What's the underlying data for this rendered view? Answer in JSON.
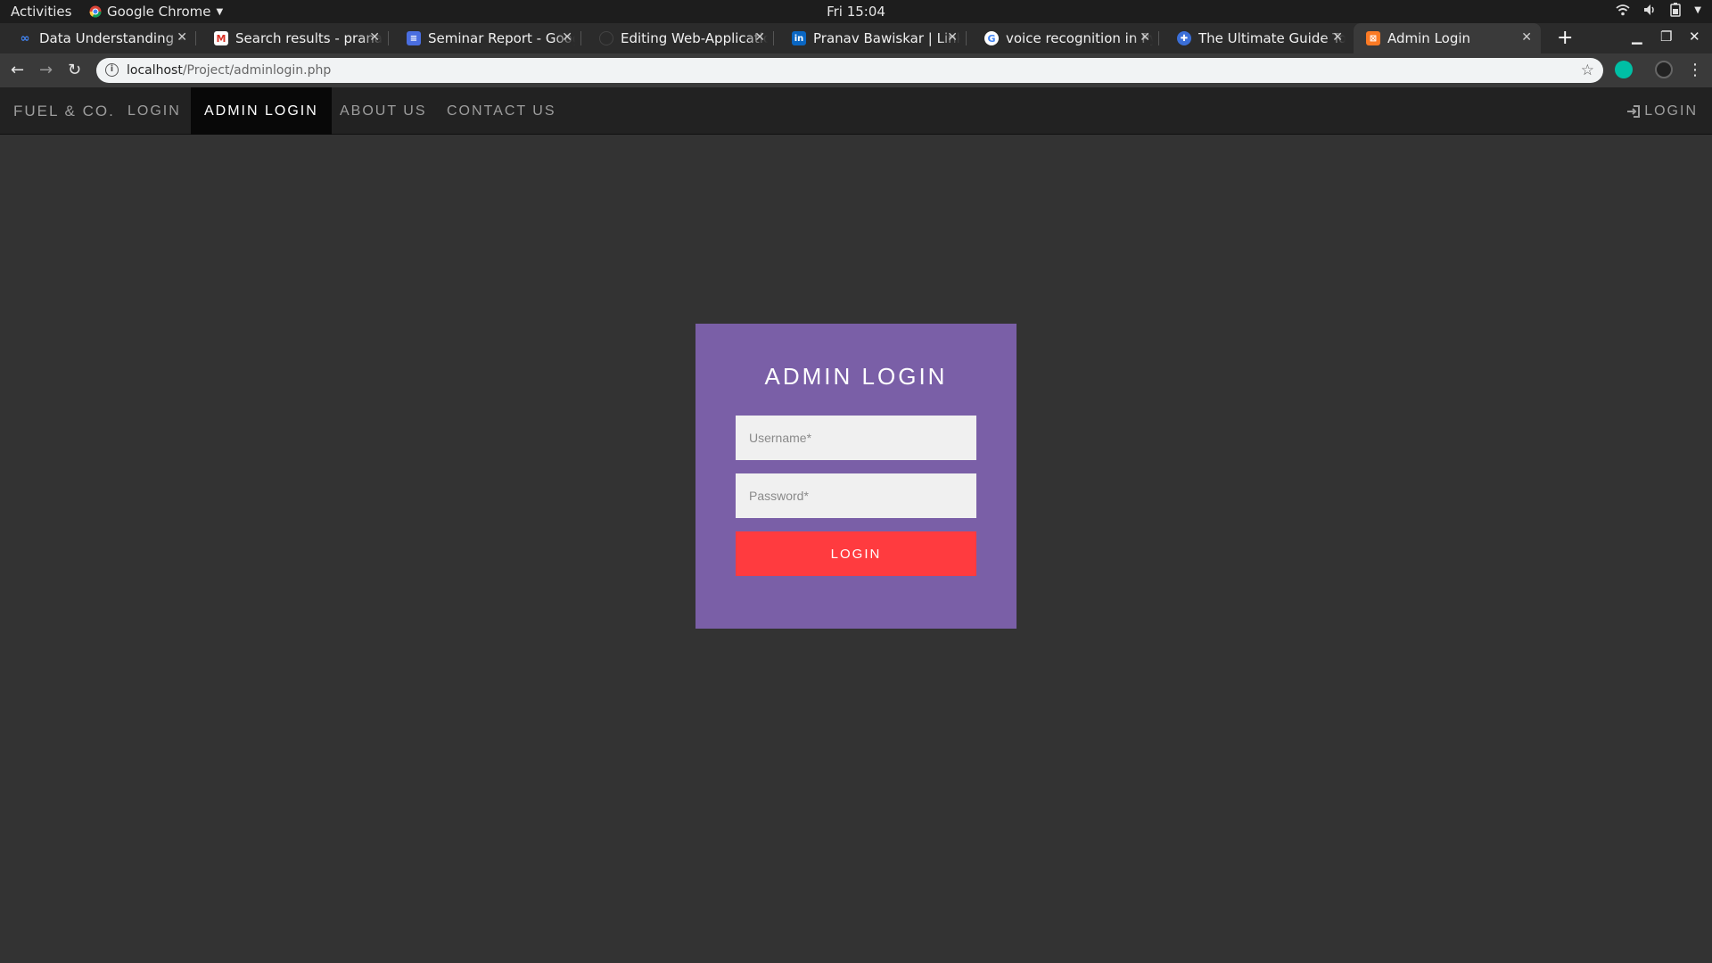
{
  "os_bar": {
    "activities": "Activities",
    "app_name": "Google Chrome",
    "clock": "Fri 15:04"
  },
  "tabs": [
    {
      "title": "Data Understanding - I",
      "icon": "colab-icon",
      "active": false
    },
    {
      "title": "Search results - pranav",
      "icon": "gmail-icon",
      "active": false
    },
    {
      "title": "Seminar Report - Google Docs",
      "icon": "docs-icon",
      "active": false
    },
    {
      "title": "Editing Web-Applicatio",
      "icon": "github-icon",
      "active": false
    },
    {
      "title": "Pranav Bawiskar | LinkedIn",
      "icon": "linkedin-icon",
      "active": false
    },
    {
      "title": "voice recognition in Py",
      "icon": "google-icon",
      "active": false
    },
    {
      "title": "The Ultimate Guide To",
      "icon": "puzzle-icon",
      "active": false
    },
    {
      "title": "Admin Login",
      "icon": "xampp-icon",
      "active": true
    }
  ],
  "address_bar": {
    "host": "localhost",
    "path": "/Project/adminlogin.php"
  },
  "navbar": {
    "brand": "FUEL & CO.",
    "links": [
      "LOGIN",
      "ADMIN LOGIN",
      "ABOUT US",
      "CONTACT US"
    ],
    "active_link": "ADMIN LOGIN",
    "right_login": "LOGIN"
  },
  "login_form": {
    "title": "ADMIN LOGIN",
    "username_placeholder": "Username*",
    "password_placeholder": "Password*",
    "button_label": "LOGIN"
  },
  "colors": {
    "page_bg": "#333333",
    "navbar_bg": "#222222",
    "card_bg": "#7a5fa7",
    "button_bg": "#ff3b3f"
  }
}
